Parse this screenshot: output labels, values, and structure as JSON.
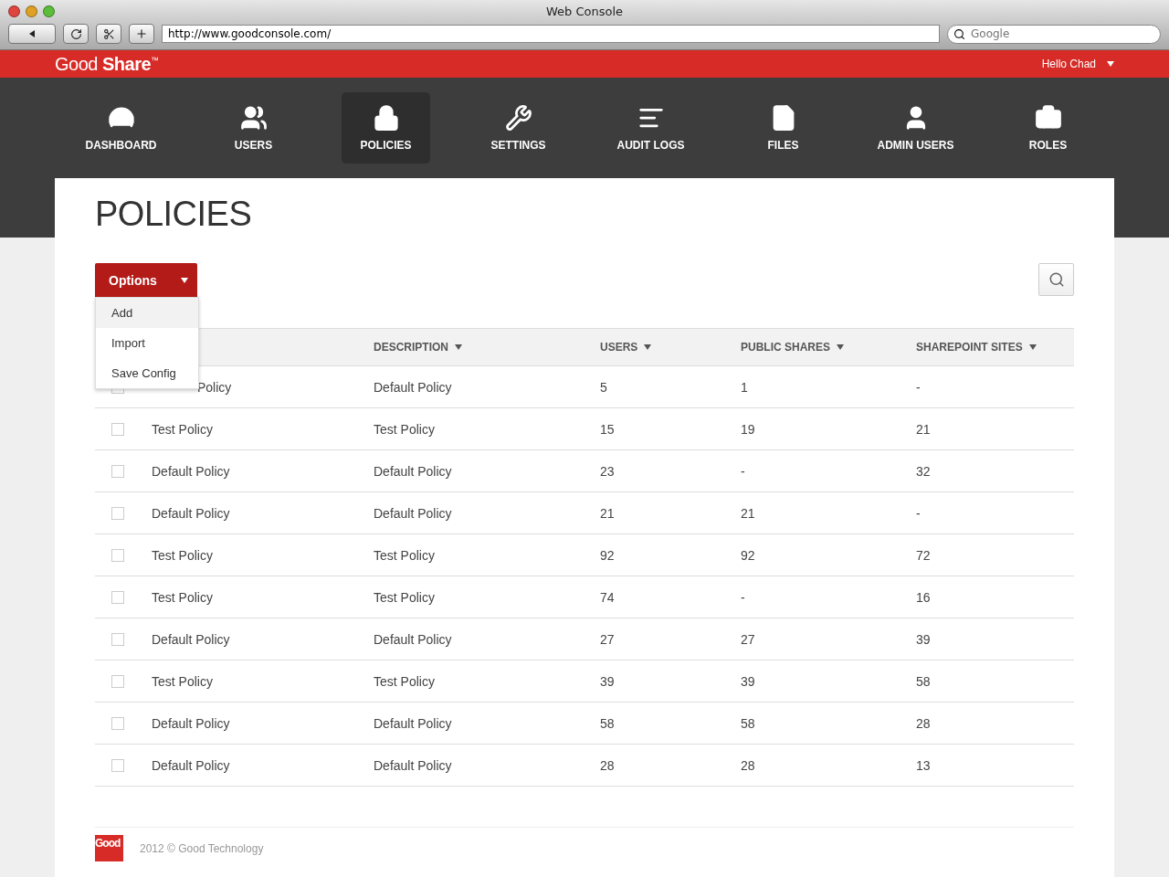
{
  "window": {
    "title": "Web Console",
    "url": "http://www.goodconsole.com/",
    "search": {
      "placeholder": "Google"
    }
  },
  "header": {
    "brand": "Good **Share**$^{™}$",
    "user": "Hello Chad"
  },
  "nav": [
    {
      "label": "DASHBOARD",
      "selected": false
    },
    {
      "label": "USERS",
      "selected": false
    },
    {
      "label": "POLICIES",
      "selected": true
    },
    {
      "label": "SETTINGS",
      "selected": false
    },
    {
      "label": "AUDIT LOGS",
      "selected": false
    },
    {
      "label": "FILES",
      "selected": false
    },
    {
      "label": "ADMIN USERS",
      "selected": false
    },
    {
      "label": "ROLES",
      "selected": false
    }
  ],
  "page_title": "POLICIES",
  "options": {
    "label": "Options",
    "menu": [
      {
        "label": "Add",
        "selected": true
      },
      {
        "label": "Import",
        "selected": false
      },
      {
        "label": "Save Config",
        "selected": false
      }
    ]
  },
  "table": {
    "columns": [
      "DESCRIPTION",
      "USERS",
      "PUBLIC SHARES",
      "SHAREPOINT SITES"
    ],
    "rows": [
      {
        "checked": false,
        "name": "Policy",
        "covered": true,
        "description": "Default Policy",
        "users": "5",
        "public_shares": "1",
        "sharepoint_sites": "-"
      },
      {
        "checked": false,
        "name": "Test Policy",
        "description": "Test Policy",
        "users": "15",
        "public_shares": "19",
        "sharepoint_sites": "21"
      },
      {
        "checked": false,
        "name": "Default Policy",
        "description": "Default Policy",
        "users": "23",
        "public_shares": "-",
        "sharepoint_sites": "32"
      },
      {
        "checked": false,
        "name": "Default Policy",
        "description": "Default Policy",
        "users": "21",
        "public_shares": "21",
        "sharepoint_sites": "-"
      },
      {
        "checked": false,
        "name": "Test Policy",
        "description": "Test Policy",
        "users": "92",
        "public_shares": "92",
        "sharepoint_sites": "72"
      },
      {
        "checked": false,
        "name": "Test Policy",
        "description": "Test Policy",
        "users": "74",
        "public_shares": "-",
        "sharepoint_sites": "16"
      },
      {
        "checked": false,
        "name": "Default Policy",
        "description": "Default Policy",
        "users": "27",
        "public_shares": "27",
        "sharepoint_sites": "39"
      },
      {
        "checked": false,
        "name": "Test Policy",
        "description": "Test Policy",
        "users": "39",
        "public_shares": "39",
        "sharepoint_sites": "58"
      },
      {
        "checked": false,
        "name": "Default Policy",
        "description": "Default Policy",
        "users": "58",
        "public_shares": "58",
        "sharepoint_sites": "28"
      },
      {
        "checked": false,
        "name": "Default Policy",
        "description": "Default Policy",
        "users": "28",
        "public_shares": "28",
        "sharepoint_sites": "13"
      }
    ]
  },
  "footer": {
    "logo": "Good",
    "copyright": "2012 © Good Technology"
  }
}
